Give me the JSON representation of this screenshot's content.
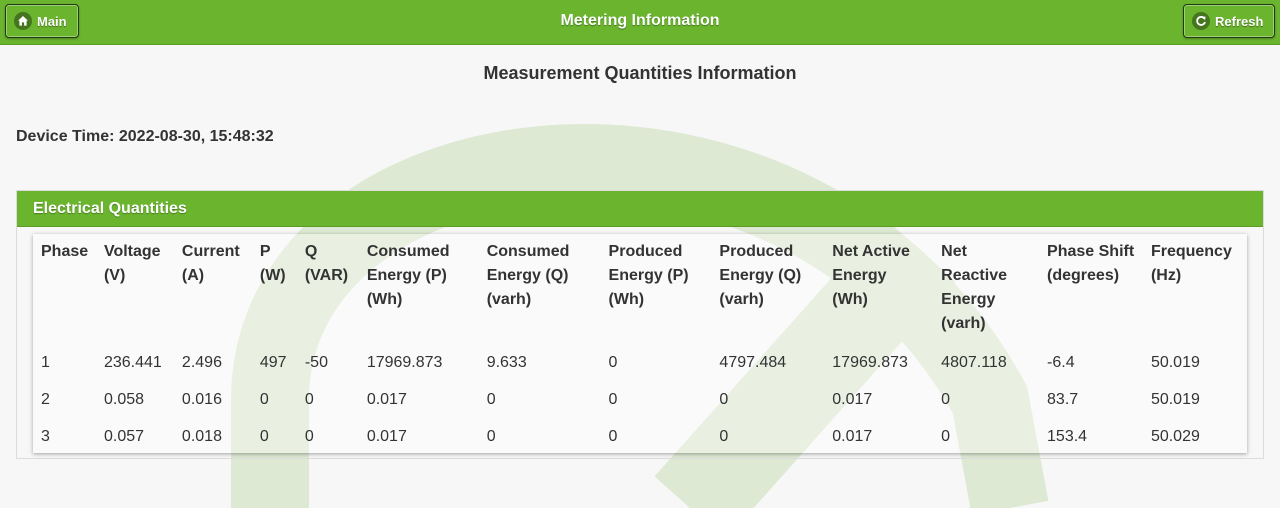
{
  "header": {
    "title": "Metering Information",
    "main_label": "Main",
    "refresh_label": "Refresh"
  },
  "page": {
    "title": "Measurement Quantities Information",
    "device_time": "Device Time: 2022-08-30, 15:48:32"
  },
  "panel": {
    "title": "Electrical Quantities"
  },
  "table": {
    "headers": [
      [
        "Phase"
      ],
      [
        "Voltage",
        "(V)"
      ],
      [
        "Current",
        "(A)"
      ],
      [
        "P",
        "(W)"
      ],
      [
        "Q",
        "(VAR)"
      ],
      [
        "Consumed",
        "Energy (P)",
        "(Wh)"
      ],
      [
        "Consumed",
        "Energy (Q)",
        "(varh)"
      ],
      [
        "Produced",
        "Energy (P)",
        "(Wh)"
      ],
      [
        "Produced",
        "Energy (Q)",
        "(varh)"
      ],
      [
        "Net Active",
        "Energy",
        "(Wh)"
      ],
      [
        "Net",
        "Reactive",
        "Energy",
        "(varh)"
      ],
      [
        "Phase Shift",
        "(degrees)"
      ],
      [
        "Frequency",
        "(Hz)"
      ]
    ],
    "rows": [
      [
        "1",
        "236.441",
        "2.496",
        "497",
        "-50",
        "17969.873",
        "9.633",
        "0",
        "4797.484",
        "17969.873",
        "4807.118",
        "-6.4",
        "50.019"
      ],
      [
        "2",
        "0.058",
        "0.016",
        "0",
        "0",
        "0.017",
        "0",
        "0",
        "0",
        "0.017",
        "0",
        "83.7",
        "50.019"
      ],
      [
        "3",
        "0.057",
        "0.018",
        "0",
        "0",
        "0.017",
        "0",
        "0",
        "0",
        "0.017",
        "0",
        "153.4",
        "50.029"
      ]
    ]
  },
  "icons": {
    "main": "home-icon",
    "refresh": "refresh-icon"
  },
  "colors": {
    "accent": "#6ab42e",
    "watermark": "#dde9d3",
    "background": "#f7f7f7"
  }
}
